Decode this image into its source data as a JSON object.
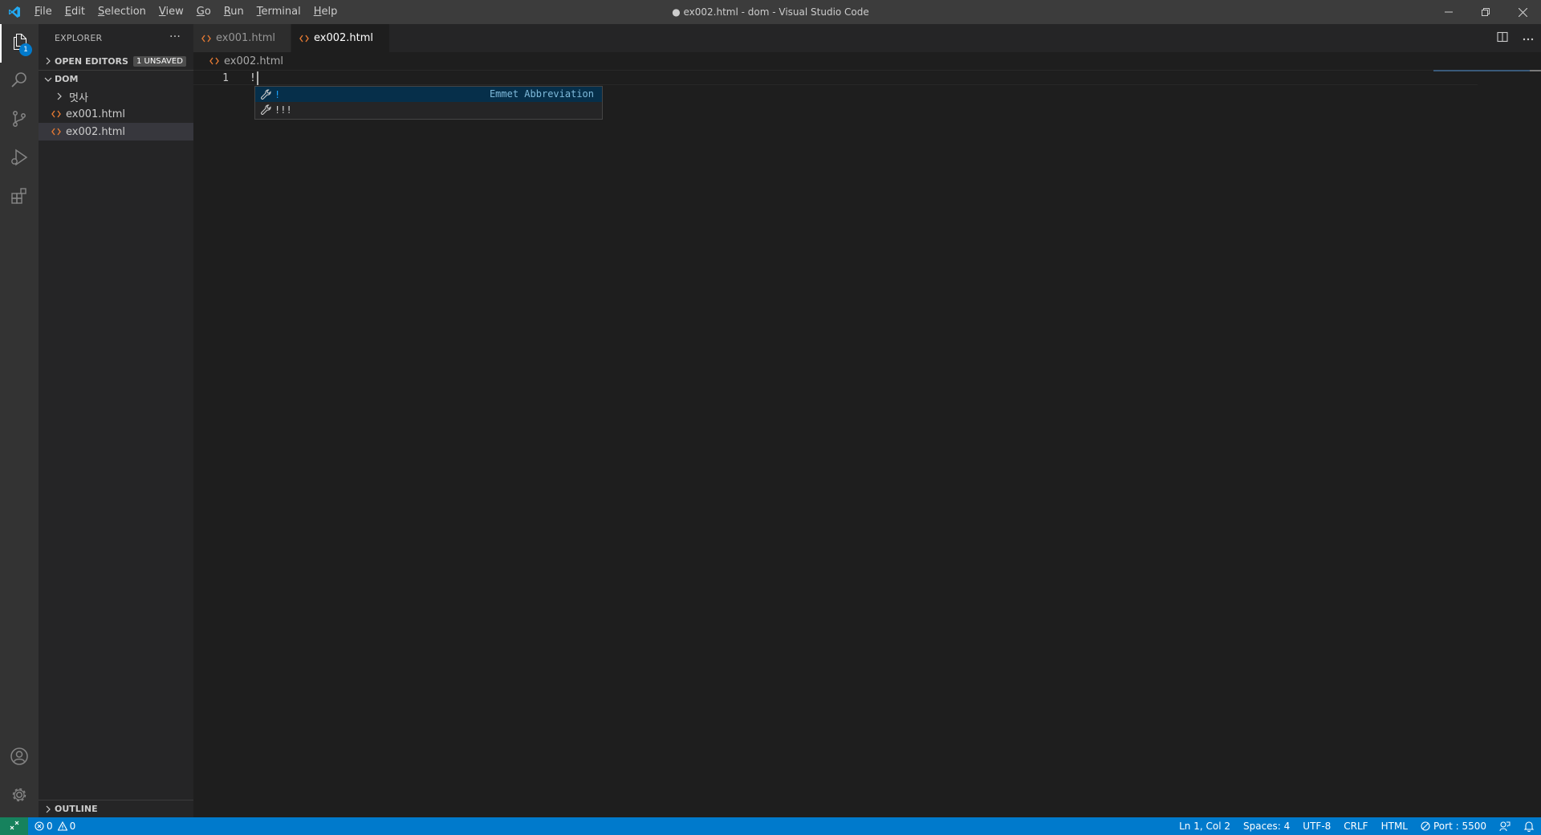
{
  "window": {
    "title": "● ex002.html - dom - Visual Studio Code"
  },
  "menu": [
    {
      "mnemonic": "F",
      "rest": "ile"
    },
    {
      "mnemonic": "E",
      "rest": "dit"
    },
    {
      "mnemonic": "S",
      "rest": "election"
    },
    {
      "mnemonic": "V",
      "rest": "iew"
    },
    {
      "mnemonic": "G",
      "rest": "o"
    },
    {
      "mnemonic": "R",
      "rest": "un"
    },
    {
      "mnemonic": "T",
      "rest": "erminal"
    },
    {
      "mnemonic": "H",
      "rest": "elp"
    }
  ],
  "activity": {
    "explorer_badge": "1",
    "icons": [
      "files-icon",
      "search-icon",
      "source-control-icon",
      "run-debug-icon",
      "extensions-icon",
      "account-icon",
      "gear-icon"
    ]
  },
  "sidebar": {
    "title": "EXPLORER",
    "more": "···",
    "open_editors": {
      "label": "OPEN EDITORS",
      "badge": "1 UNSAVED"
    },
    "folder": {
      "label": "DOM"
    },
    "items": [
      {
        "label": "멋사",
        "kind": "folder"
      },
      {
        "label": "ex001.html",
        "kind": "html"
      },
      {
        "label": "ex002.html",
        "kind": "html",
        "selected": true
      }
    ],
    "outline": "OUTLINE"
  },
  "tabs": [
    {
      "label": "ex001.html",
      "active": false
    },
    {
      "label": "ex002.html",
      "active": true,
      "dirty": true
    }
  ],
  "breadcrumb": {
    "file": "ex002.html"
  },
  "editor": {
    "line_number": "1",
    "line_text": "!"
  },
  "suggest": {
    "items": [
      {
        "label": "!",
        "detail": "Emmet Abbreviation",
        "focused": true
      },
      {
        "label": "!!!",
        "detail": "",
        "focused": false
      }
    ]
  },
  "status": {
    "errors": "0",
    "warnings": "0",
    "position": "Ln 1, Col 2",
    "spaces": "Spaces: 4",
    "encoding": "UTF-8",
    "eol": "CRLF",
    "language": "HTML",
    "port": "Port : 5500"
  },
  "colors": {
    "accent": "#007acc",
    "html_icon": "#e37933",
    "remote": "#16825d"
  }
}
